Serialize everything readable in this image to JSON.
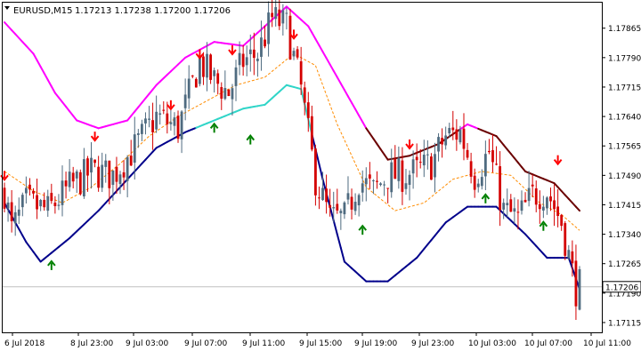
{
  "header": {
    "symbol_timeframe": "EURUSD,M15",
    "ohlc": "1.17213 1.17238 1.17200 1.17206",
    "menu_icon": "triangle-down-icon"
  },
  "colors": {
    "background": "#ffffff",
    "frame": "#000000",
    "bull_candle": "#4f6b80",
    "bear_candle": "#d40000",
    "upper_band_high": "#ff00ff",
    "upper_band_low": "#6b0000",
    "lower_band_high": "#00008b",
    "lower_band_low": "#30d5c8",
    "middle_line": "#ff8c00",
    "buy_arrow": "#008000",
    "sell_arrow": "#ff0000",
    "price_line": "#c0c0c0",
    "price_tag_bg": "#ffffff"
  },
  "chart_data": {
    "type": "candlestick",
    "title": "EURUSD,M15",
    "current_price": "1.17206",
    "ylim": [
      1.1709,
      1.1793
    ],
    "y_ticks": [
      "1.17865",
      "1.17790",
      "1.17715",
      "1.17640",
      "1.17565",
      "1.17490",
      "1.17415",
      "1.17340",
      "1.17265",
      "1.17190",
      "1.17115"
    ],
    "x_ticks": [
      "6 Jul 2018",
      "8 Jul 23:00",
      "9 Jul 03:00",
      "9 Jul 07:00",
      "9 Jul 11:00",
      "9 Jul 15:00",
      "9 Jul 19:00",
      "9 Jul 23:00",
      "10 Jul 03:00",
      "10 Jul 07:00",
      "10 Jul 11:00"
    ],
    "candle_count": 160,
    "price_anchors": [
      [
        0,
        1.1745
      ],
      [
        2,
        1.1735
      ],
      [
        6,
        1.1742
      ],
      [
        12,
        1.174
      ],
      [
        18,
        1.1746
      ],
      [
        24,
        1.175
      ],
      [
        30,
        1.1749
      ],
      [
        36,
        1.1756
      ],
      [
        42,
        1.1764
      ],
      [
        48,
        1.1761
      ],
      [
        54,
        1.1778
      ],
      [
        58,
        1.1773
      ],
      [
        62,
        1.177
      ],
      [
        66,
        1.1778
      ],
      [
        70,
        1.178
      ],
      [
        74,
        1.1789
      ],
      [
        78,
        1.1787
      ],
      [
        82,
        1.1771
      ],
      [
        86,
        1.1748
      ],
      [
        90,
        1.1738
      ],
      [
        94,
        1.1738
      ],
      [
        98,
        1.1748
      ],
      [
        102,
        1.1745
      ],
      [
        106,
        1.1749
      ],
      [
        110,
        1.1749
      ],
      [
        114,
        1.175
      ],
      [
        118,
        1.1752
      ],
      [
        122,
        1.1759
      ],
      [
        126,
        1.176
      ],
      [
        130,
        1.1749
      ],
      [
        134,
        1.1755
      ],
      [
        138,
        1.174
      ],
      [
        142,
        1.1738
      ],
      [
        146,
        1.1744
      ],
      [
        150,
        1.1745
      ],
      [
        154,
        1.1737
      ],
      [
        158,
        1.172
      ],
      [
        159,
        1.1721
      ]
    ],
    "upper_band": [
      [
        0,
        1.1788
      ],
      [
        8,
        1.178
      ],
      [
        14,
        1.177
      ],
      [
        20,
        1.1763
      ],
      [
        26,
        1.1761
      ],
      [
        34,
        1.1763
      ],
      [
        42,
        1.1772
      ],
      [
        50,
        1.1779
      ],
      [
        58,
        1.1783
      ],
      [
        66,
        1.1782
      ],
      [
        72,
        1.1787
      ],
      [
        78,
        1.1792
      ],
      [
        84,
        1.1787
      ],
      [
        92,
        1.1774
      ],
      [
        100,
        1.1761
      ],
      [
        106,
        1.1753
      ],
      [
        112,
        1.1754
      ],
      [
        120,
        1.1757
      ],
      [
        128,
        1.1762
      ],
      [
        136,
        1.1759
      ],
      [
        144,
        1.175
      ],
      [
        152,
        1.1747
      ],
      [
        159,
        1.174
      ]
    ],
    "lower_band": [
      [
        0,
        1.1742
      ],
      [
        6,
        1.1732
      ],
      [
        10,
        1.1727
      ],
      [
        18,
        1.1733
      ],
      [
        26,
        1.174
      ],
      [
        34,
        1.1748
      ],
      [
        42,
        1.1756
      ],
      [
        50,
        1.176
      ],
      [
        58,
        1.1763
      ],
      [
        66,
        1.1766
      ],
      [
        72,
        1.1767
      ],
      [
        78,
        1.1772
      ],
      [
        82,
        1.1771
      ],
      [
        88,
        1.1748
      ],
      [
        94,
        1.1727
      ],
      [
        100,
        1.1722
      ],
      [
        106,
        1.1722
      ],
      [
        114,
        1.1728
      ],
      [
        122,
        1.1737
      ],
      [
        128,
        1.1741
      ],
      [
        136,
        1.1741
      ],
      [
        144,
        1.1734
      ],
      [
        150,
        1.1728
      ],
      [
        156,
        1.1728
      ],
      [
        159,
        1.172
      ]
    ],
    "band_split": 1.1753,
    "middle_line": [
      [
        0,
        1.175
      ],
      [
        8,
        1.1745
      ],
      [
        16,
        1.1742
      ],
      [
        24,
        1.1746
      ],
      [
        32,
        1.1752
      ],
      [
        40,
        1.1759
      ],
      [
        48,
        1.1764
      ],
      [
        56,
        1.1768
      ],
      [
        64,
        1.1772
      ],
      [
        72,
        1.1774
      ],
      [
        80,
        1.178
      ],
      [
        86,
        1.1777
      ],
      [
        92,
        1.1762
      ],
      [
        100,
        1.1746
      ],
      [
        108,
        1.174
      ],
      [
        116,
        1.1742
      ],
      [
        124,
        1.1748
      ],
      [
        132,
        1.175
      ],
      [
        140,
        1.1749
      ],
      [
        148,
        1.1742
      ],
      [
        154,
        1.1739
      ],
      [
        159,
        1.1735
      ]
    ],
    "sell_arrows": [
      [
        0,
        1.1749
      ],
      [
        25,
        1.1759
      ],
      [
        46,
        1.1767
      ],
      [
        54,
        1.178
      ],
      [
        63,
        1.1781
      ],
      [
        80,
        1.1785
      ],
      [
        112,
        1.1757
      ],
      [
        153,
        1.1753
      ]
    ],
    "buy_arrows": [
      [
        13,
        1.1726
      ],
      [
        58,
        1.1761
      ],
      [
        68,
        1.1758
      ],
      [
        99,
        1.1735
      ],
      [
        133,
        1.1743
      ],
      [
        149,
        1.1736
      ]
    ]
  }
}
